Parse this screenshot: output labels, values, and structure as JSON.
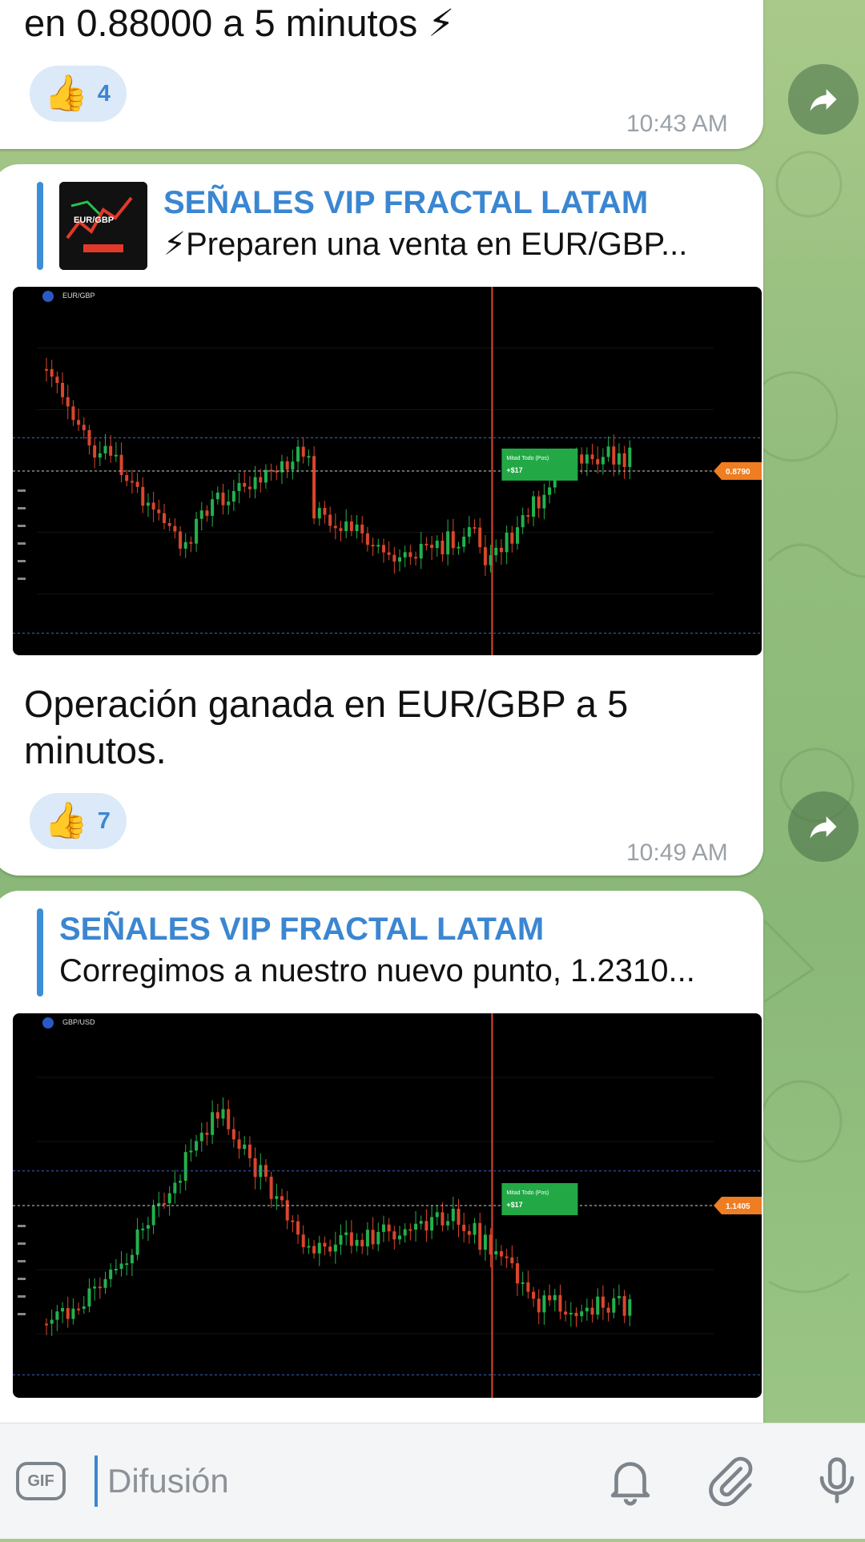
{
  "messages": [
    {
      "text": "en 0.88000 a 5 minutos ⚡",
      "reaction": {
        "emoji": "👍",
        "count": "4"
      },
      "time": "10:43 AM"
    },
    {
      "reply": {
        "title": "SEÑALES VIP FRACTAL LATAM",
        "text": "⚡Preparen una venta en EUR/GBP...",
        "thumb_labels": [
          "EUR/GBP"
        ]
      },
      "chart": {
        "symbol": "EUR/GBP",
        "trade_label": "Mitad Todo (Pos)",
        "trade_value": "+$17",
        "price_tag": "0.8790"
      },
      "text": "Operación ganada en EUR/GBP a 5 minutos.",
      "reaction": {
        "emoji": "👍",
        "count": "7"
      },
      "time": "10:49 AM"
    },
    {
      "reply": {
        "title": "SEÑALES VIP FRACTAL LATAM",
        "text": "Corregimos a nuestro nuevo punto, 1.2310..."
      },
      "chart": {
        "symbol": "GBP/USD",
        "trade_label": "Mitad Todo (Pos)",
        "trade_value": "+$17",
        "price_tag": "1.1405"
      }
    }
  ],
  "composer": {
    "gif_label": "GIF",
    "placeholder": "Difusión"
  },
  "colors": {
    "accent": "#3b86d1",
    "wallpaper": "#93bd7d",
    "bull": "#23b14d",
    "bear": "#d9462c"
  },
  "icons": [
    "share-icon",
    "bell-icon",
    "attach-icon",
    "mic-icon",
    "gif-icon",
    "thumbs-up-icon"
  ]
}
